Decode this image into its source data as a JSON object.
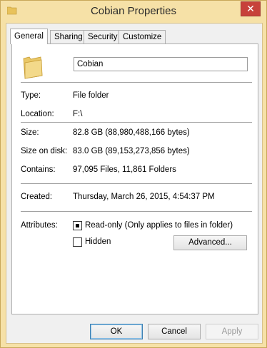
{
  "window": {
    "title": "Cobian Properties",
    "close_label": "✕"
  },
  "tabs": [
    {
      "label": "General",
      "active": true
    },
    {
      "label": "Sharing"
    },
    {
      "label": "Security"
    },
    {
      "label": "Customize"
    }
  ],
  "general": {
    "name_value": "Cobian",
    "rows": {
      "type": {
        "label": "Type:",
        "value": "File folder"
      },
      "location": {
        "label": "Location:",
        "value": "F:\\"
      },
      "size": {
        "label": "Size:",
        "value": "82.8 GB (88,980,488,166 bytes)"
      },
      "size_on_disk": {
        "label": "Size on disk:",
        "value": "83.0 GB (89,153,273,856 bytes)"
      },
      "contains": {
        "label": "Contains:",
        "value": "97,095 Files, 11,861 Folders"
      },
      "created": {
        "label": "Created:",
        "value": "Thursday, March 26, 2015, 4:54:37 PM"
      }
    },
    "attributes": {
      "label": "Attributes:",
      "readonly_label": "Read-only (Only applies to files in folder)",
      "readonly_state": "indeterminate",
      "hidden_label": "Hidden",
      "hidden_checked": false,
      "advanced_label": "Advanced..."
    }
  },
  "buttons": {
    "ok": "OK",
    "cancel": "Cancel",
    "apply": "Apply"
  },
  "icons": {
    "title_icon": "folder-icon",
    "folder_icon": "folder-icon",
    "close_icon": "close-icon"
  },
  "colors": {
    "title_bar": "#f6e1a7",
    "close_button": "#c7413a",
    "dialog_bg": "#f0f0f0",
    "panel_bg": "#ffffff"
  }
}
